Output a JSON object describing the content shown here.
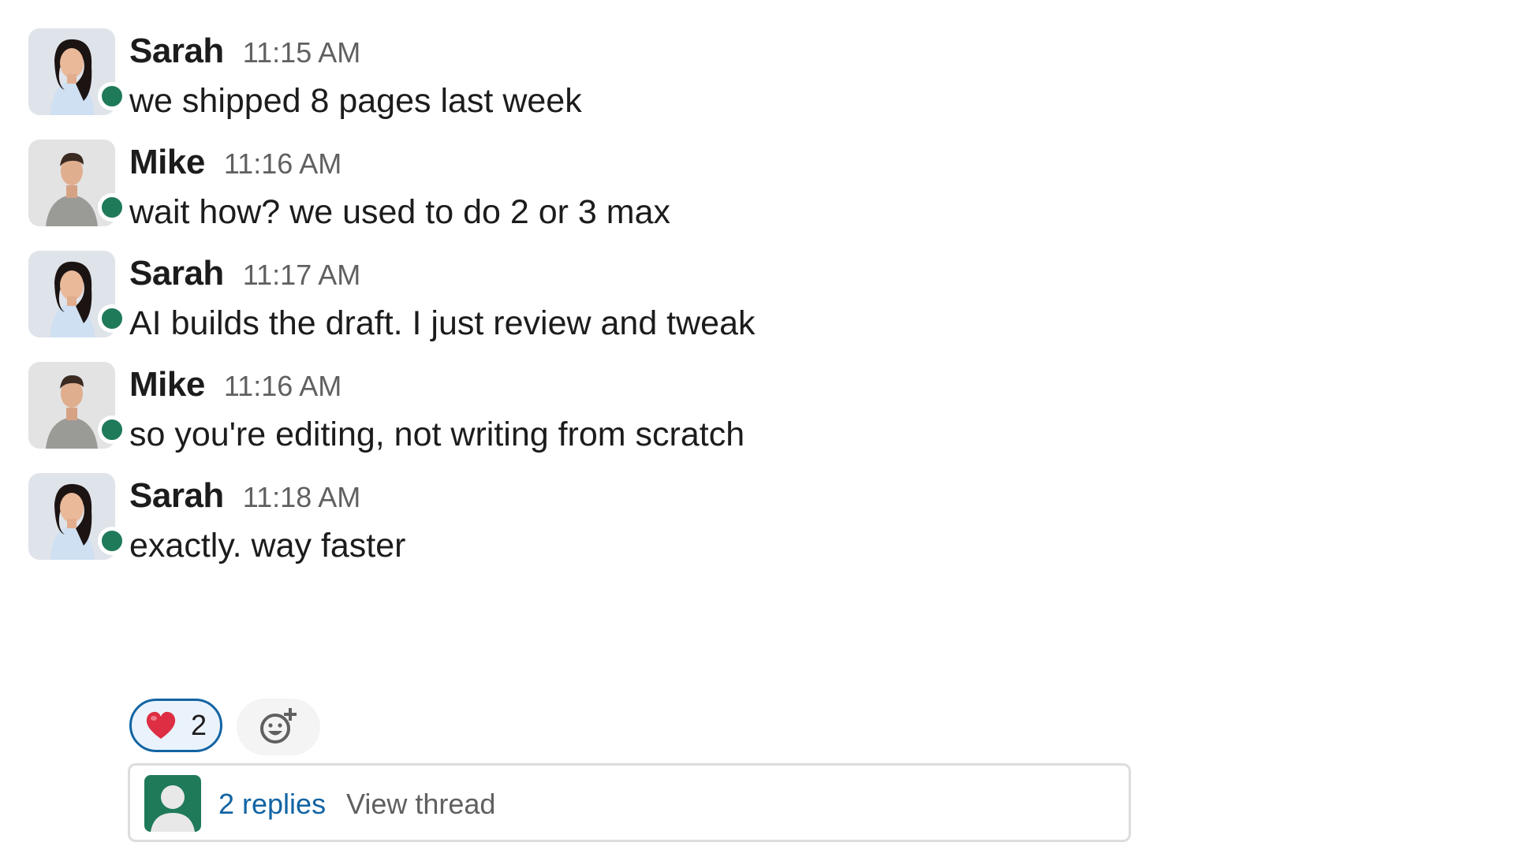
{
  "messages": [
    {
      "author": "Sarah",
      "time": "11:15 AM",
      "text": "we shipped 8 pages last week",
      "avatar": "sarah",
      "status": "online"
    },
    {
      "author": "Mike",
      "time": "11:16 AM",
      "text": "wait how? we used to do 2 or 3 max",
      "avatar": "mike",
      "status": "online"
    },
    {
      "author": "Sarah",
      "time": "11:17 AM",
      "text": "AI builds the draft. I just review and tweak",
      "avatar": "sarah",
      "status": "online"
    },
    {
      "author": "Mike",
      "time": "11:16 AM",
      "text": "so you're editing, not writing from scratch",
      "avatar": "mike",
      "status": "online"
    },
    {
      "author": "Sarah",
      "time": "11:18 AM",
      "text": "exactly. way faster",
      "avatar": "sarah",
      "status": "online"
    }
  ],
  "reactions": [
    {
      "emoji": "❤️",
      "icon": "heart-icon",
      "count": "2",
      "selected": true
    }
  ],
  "add_reaction_icon": "add-emoji-icon",
  "thread": {
    "replies": "2 replies",
    "view": "View thread"
  },
  "colors": {
    "presence": "#1f7a5a",
    "link": "#1264a3",
    "reaction_bg": "#eaf3fb",
    "timestamp": "#616061"
  }
}
